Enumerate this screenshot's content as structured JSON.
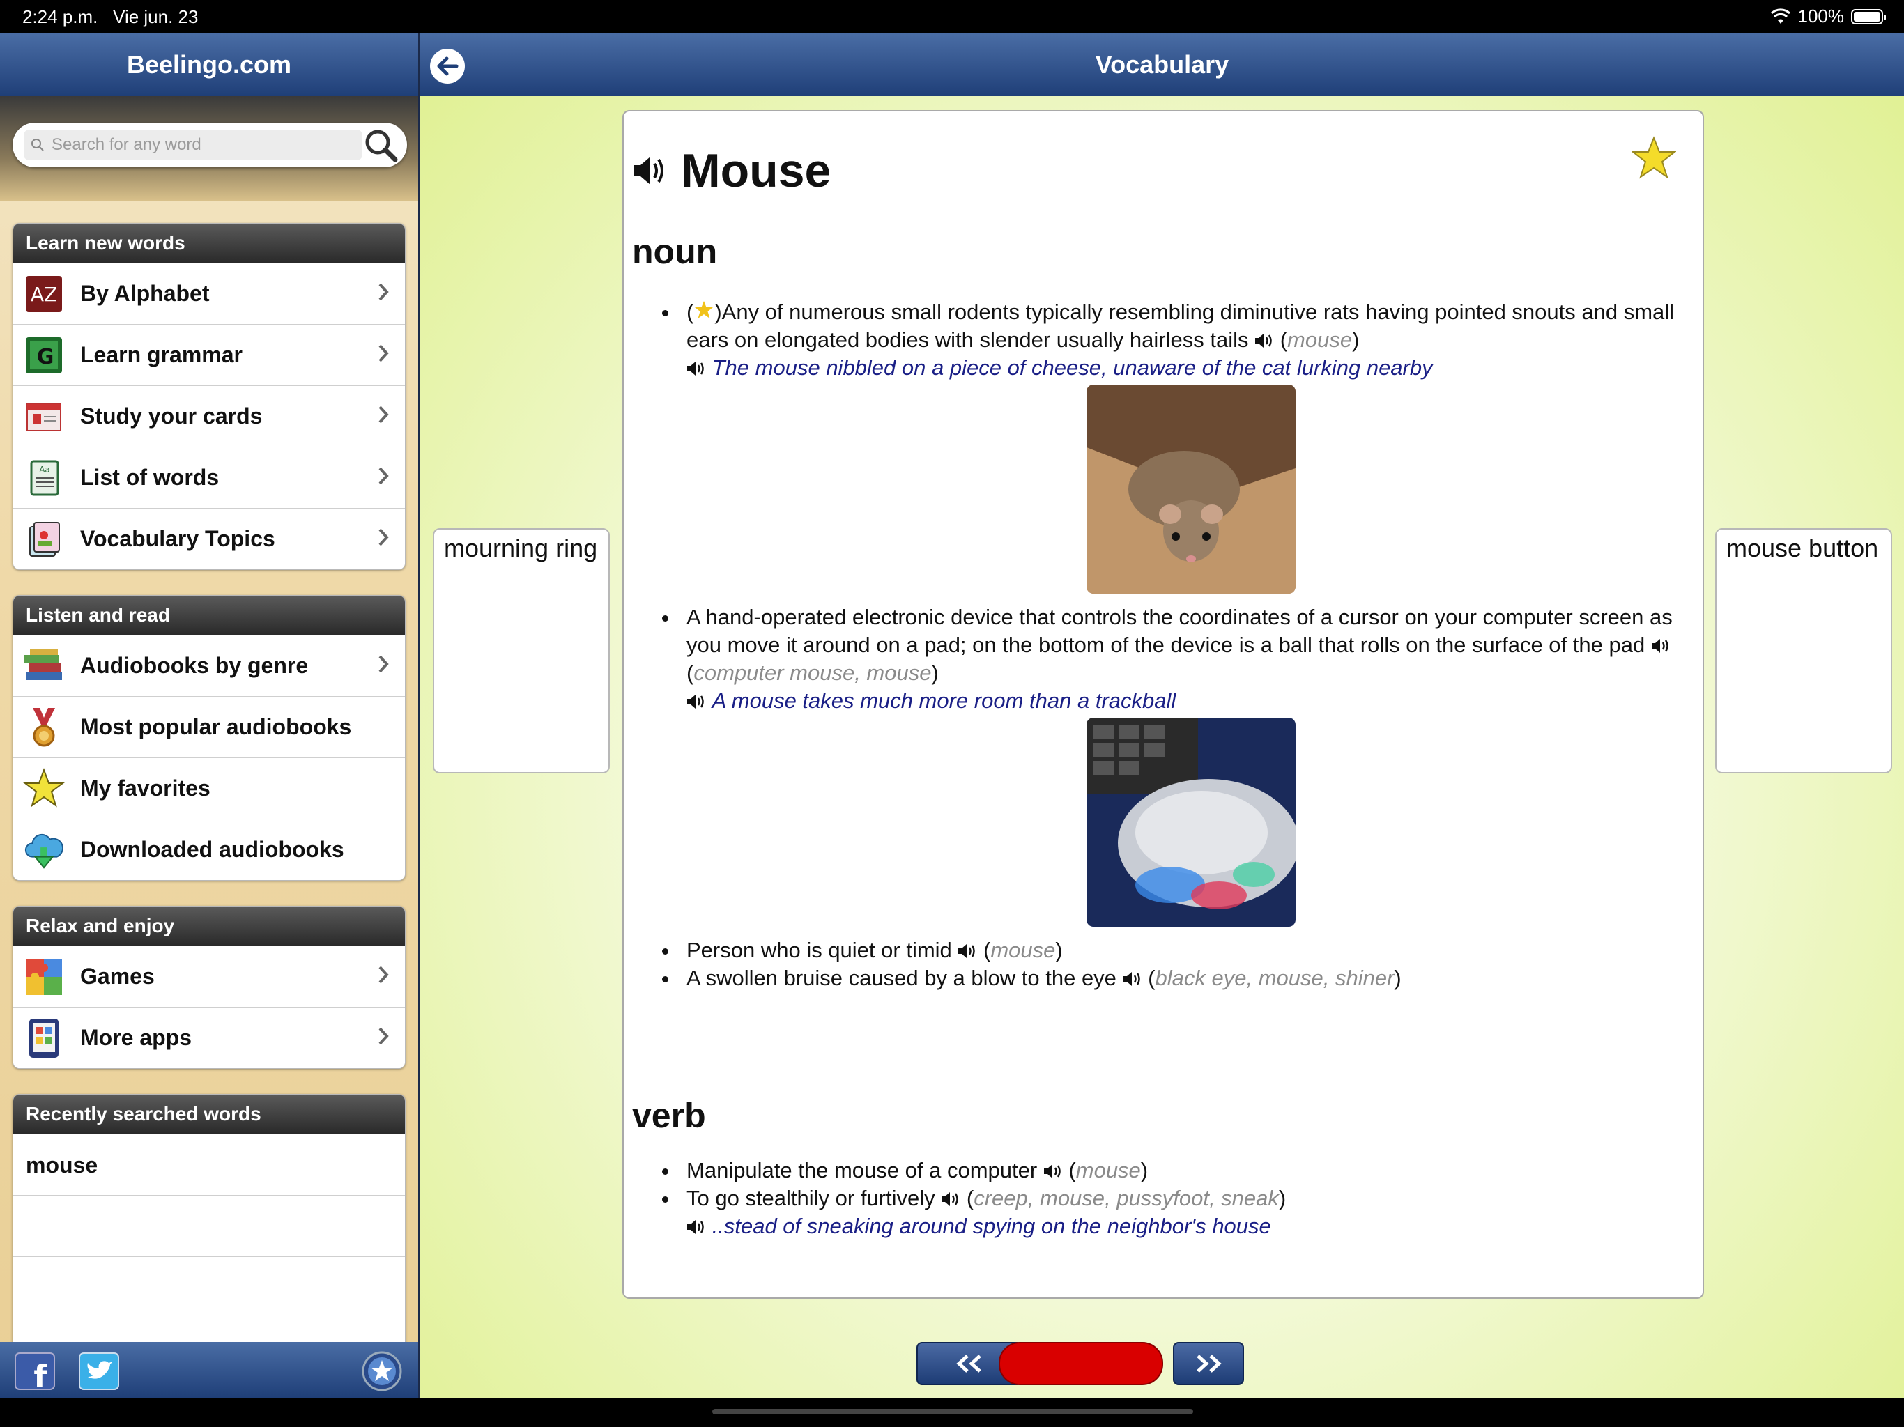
{
  "status": {
    "time": "2:24 p.m.",
    "date": "Vie jun. 23",
    "battery": "100%"
  },
  "sidebar": {
    "title": "Beelingo.com",
    "search_placeholder": "Search for any word",
    "learn": {
      "title": "Learn new words",
      "items": [
        "By Alphabet",
        "Learn grammar",
        "Study your cards",
        "List of words",
        "Vocabulary Topics"
      ]
    },
    "listen": {
      "title": "Listen and read",
      "items": [
        "Audiobooks by genre",
        "Most popular audiobooks",
        "My favorites",
        "Downloaded audiobooks"
      ]
    },
    "relax": {
      "title": "Relax and enjoy",
      "items": [
        "Games",
        "More apps"
      ]
    },
    "recent": {
      "title": "Recently searched words",
      "items": [
        "mouse"
      ]
    }
  },
  "main": {
    "title": "Vocabulary",
    "prev_word": "mourning ring",
    "next_word": "mouse button",
    "word": "Mouse",
    "noun_label": "noun",
    "verb_label": "verb",
    "noun_defs": [
      {
        "text": "Any of numerous small rodents typically resembling diminutive rats having pointed snouts and small ears on elongated bodies with slender usually hairless tails",
        "syn": "mouse",
        "example": "The mouse nibbled on a piece of cheese, unaware of the cat lurking nearby"
      },
      {
        "text": "A hand-operated electronic device that controls the coordinates of a cursor on your computer screen as you move it around on a pad; on the bottom of the device is a ball that rolls on the surface of the pad",
        "syn": "computer mouse, mouse",
        "example": "A mouse takes much more room than a trackball"
      },
      {
        "text": "Person who is quiet or timid",
        "syn": "mouse"
      },
      {
        "text": "A swollen bruise caused by a blow to the eye",
        "syn": "black eye, mouse, shiner"
      }
    ],
    "verb_defs": [
      {
        "text": "Manipulate the mouse of a computer",
        "syn": "mouse"
      },
      {
        "text": "To go stealthily or furtively",
        "syn": "creep, mouse, pussyfoot, sneak",
        "example": "..stead of sneaking around spying on the neighbor's house"
      }
    ],
    "nav_prev_label": "<<",
    "nav_next_label": ">>"
  },
  "colors": {
    "header": "#1f3f78",
    "accent_red": "#d90000",
    "example_text": "#1a1f86"
  }
}
